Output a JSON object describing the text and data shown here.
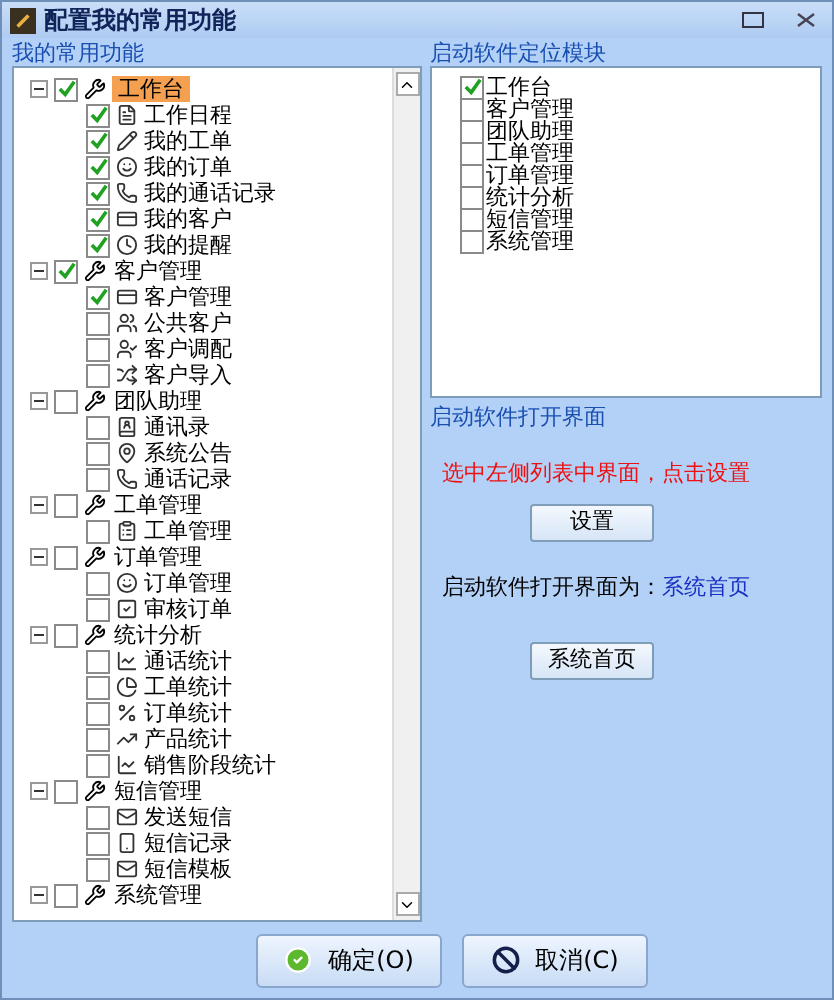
{
  "window": {
    "title": "配置我的常用功能"
  },
  "left": {
    "label": "我的常用功能",
    "tree": [
      {
        "label": "工作台",
        "checked": true,
        "selected": true,
        "expanded": true,
        "children": [
          {
            "label": "工作日程",
            "checked": true
          },
          {
            "label": "我的工单",
            "checked": true
          },
          {
            "label": "我的订单",
            "checked": true
          },
          {
            "label": "我的通话记录",
            "checked": true
          },
          {
            "label": "我的客户",
            "checked": true
          },
          {
            "label": "我的提醒",
            "checked": true
          }
        ]
      },
      {
        "label": "客户管理",
        "checked": true,
        "selected": false,
        "expanded": true,
        "children": [
          {
            "label": "客户管理",
            "checked": true
          },
          {
            "label": "公共客户",
            "checked": false
          },
          {
            "label": "客户调配",
            "checked": false
          },
          {
            "label": "客户导入",
            "checked": false
          }
        ]
      },
      {
        "label": "团队助理",
        "checked": false,
        "selected": false,
        "expanded": true,
        "children": [
          {
            "label": "通讯录",
            "checked": false
          },
          {
            "label": "系统公告",
            "checked": false
          },
          {
            "label": "通话记录",
            "checked": false
          }
        ]
      },
      {
        "label": "工单管理",
        "checked": false,
        "selected": false,
        "expanded": true,
        "children": [
          {
            "label": "工单管理",
            "checked": false
          }
        ]
      },
      {
        "label": "订单管理",
        "checked": false,
        "selected": false,
        "expanded": true,
        "children": [
          {
            "label": "订单管理",
            "checked": false
          },
          {
            "label": "审核订单",
            "checked": false
          }
        ]
      },
      {
        "label": "统计分析",
        "checked": false,
        "selected": false,
        "expanded": true,
        "children": [
          {
            "label": "通话统计",
            "checked": false
          },
          {
            "label": "工单统计",
            "checked": false
          },
          {
            "label": "订单统计",
            "checked": false
          },
          {
            "label": "产品统计",
            "checked": false
          },
          {
            "label": "销售阶段统计",
            "checked": false
          }
        ]
      },
      {
        "label": "短信管理",
        "checked": false,
        "selected": false,
        "expanded": true,
        "children": [
          {
            "label": "发送短信",
            "checked": false
          },
          {
            "label": "短信记录",
            "checked": false
          },
          {
            "label": "短信模板",
            "checked": false
          }
        ]
      },
      {
        "label": "系统管理",
        "checked": false,
        "selected": false,
        "expanded": true
      }
    ]
  },
  "right": {
    "label": "启动软件定位模块",
    "modules": [
      {
        "label": "工作台",
        "checked": true
      },
      {
        "label": "客户管理",
        "checked": false
      },
      {
        "label": "团队助理",
        "checked": false
      },
      {
        "label": "工单管理",
        "checked": false
      },
      {
        "label": "订单管理",
        "checked": false
      },
      {
        "label": "统计分析",
        "checked": false
      },
      {
        "label": "短信管理",
        "checked": false
      },
      {
        "label": "系统管理",
        "checked": false
      }
    ],
    "open_label": "启动软件打开界面",
    "hint": "选中左侧列表中界面，点击设置",
    "set_button": "设置",
    "current_prefix": "启动软件打开界面为：",
    "current_value": "系统首页",
    "page_button": "系统首页"
  },
  "buttons": [
    {
      "kind": "ok",
      "label": "确定(O)"
    },
    {
      "kind": "cancel",
      "label": "取消(C)"
    }
  ]
}
